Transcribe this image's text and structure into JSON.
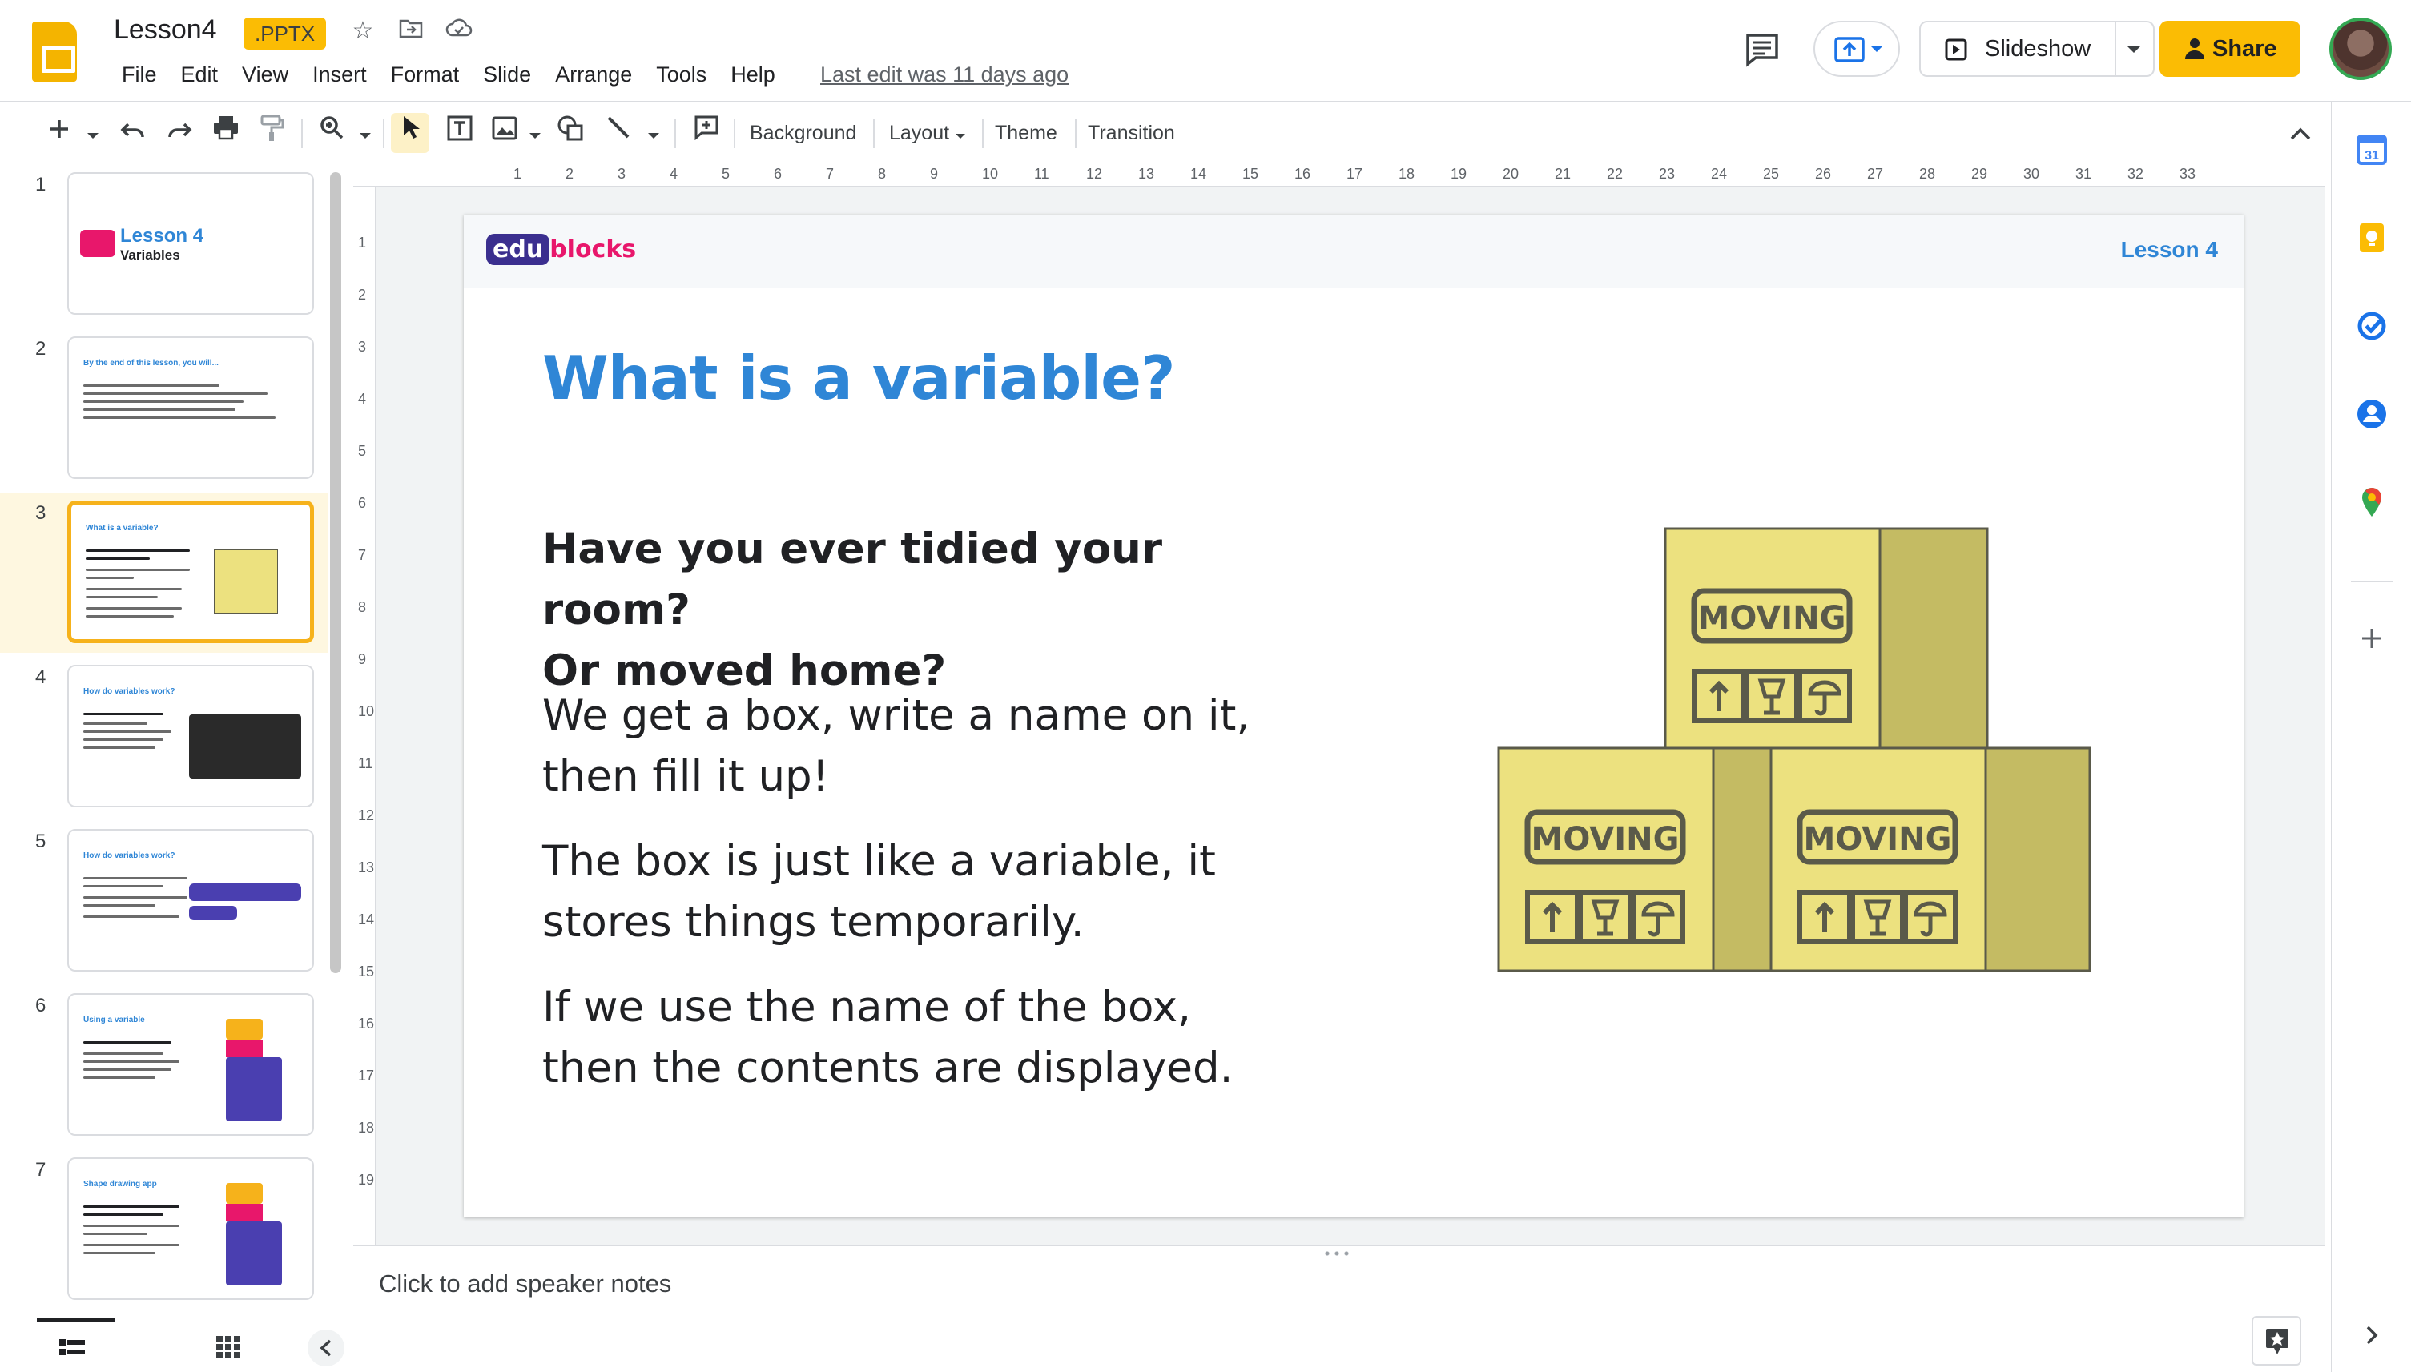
{
  "header": {
    "title": "Lesson4",
    "format_badge": ".PPTX",
    "menu": [
      "File",
      "Edit",
      "View",
      "Insert",
      "Format",
      "Slide",
      "Arrange",
      "Tools",
      "Help"
    ],
    "last_edit": "Last edit was 11 days ago",
    "slideshow_label": "Slideshow",
    "share_label": "Share"
  },
  "toolbar": {
    "background_label": "Background",
    "layout_label": "Layout",
    "theme_label": "Theme",
    "transition_label": "Transition"
  },
  "filmstrip": {
    "slides": [
      {
        "num": "1",
        "title": "Lesson 4",
        "subtitle": "Variables"
      },
      {
        "num": "2",
        "title": "By the end of this lesson, you will..."
      },
      {
        "num": "3",
        "title": "What is a variable?"
      },
      {
        "num": "4",
        "title": "How do variables work?"
      },
      {
        "num": "5",
        "title": "How do variables work?"
      },
      {
        "num": "6",
        "title": "Using a variable"
      },
      {
        "num": "7",
        "title": "Shape drawing app"
      }
    ],
    "active_index": 3
  },
  "ruler": {
    "horizontal": [
      "1",
      "2",
      "3",
      "4",
      "5",
      "6",
      "7",
      "8",
      "9",
      "10",
      "11",
      "12",
      "13",
      "14",
      "15",
      "16",
      "17",
      "18",
      "19",
      "20",
      "21",
      "22",
      "23",
      "24",
      "25",
      "26",
      "27",
      "28",
      "29",
      "30",
      "31",
      "32",
      "33"
    ],
    "vertical": [
      "1",
      "2",
      "3",
      "4",
      "5",
      "6",
      "7",
      "8",
      "9",
      "10",
      "11",
      "12",
      "13",
      "14",
      "15",
      "16",
      "17",
      "18",
      "19"
    ]
  },
  "slide": {
    "logo_edu": "edu",
    "logo_blocks": "blocks",
    "lesson_tag": "Lesson 4",
    "title": "What is a variable?",
    "question_line1": "Have you ever tidied your room?",
    "question_line2": "Or moved home?",
    "para1_line1": "We get a box, write a name on it,",
    "para1_line2": "then fill it up!",
    "para2_line1": "The box is just like a variable, it",
    "para2_line2": "stores things temporarily.",
    "para3_line1": "If we use the name of the box,",
    "para3_line2": "then the contents are displayed.",
    "box_label": "MOVING"
  },
  "notes": {
    "placeholder": "Click to add speaker notes"
  },
  "colors": {
    "accent_yellow": "#fbbc04",
    "slide_title_blue": "#2f86d6",
    "box_fill": "#ece17f",
    "box_shade": "#c4bb63",
    "box_stroke": "#5a5a4a"
  }
}
